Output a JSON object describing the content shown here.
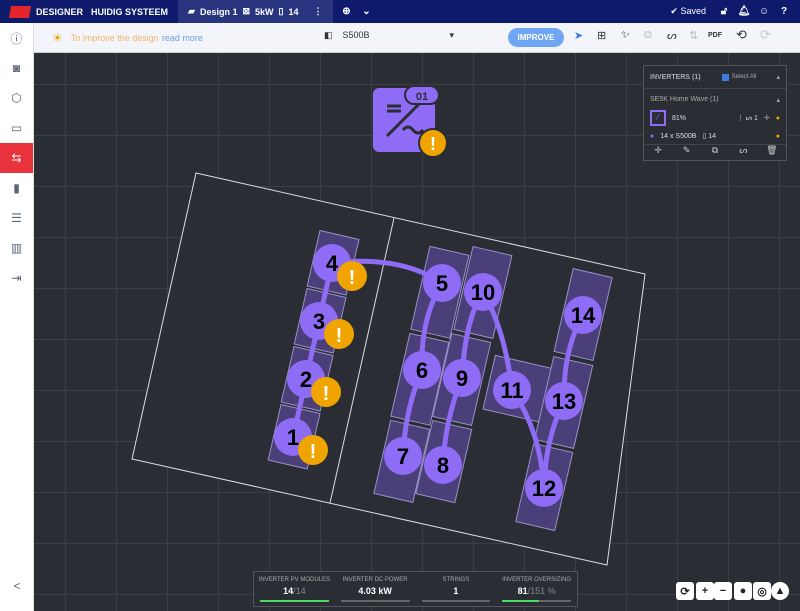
{
  "header": {
    "brand": "DESIGNER",
    "project": "HUIDIG SYSTEEM",
    "design_tab": "Design 1",
    "power": "5kW",
    "modules": "14",
    "saved": "Saved"
  },
  "sidebar": {
    "items": [
      "info",
      "camera",
      "cube",
      "panels",
      "strings",
      "inverter",
      "battery",
      "report",
      "export",
      "share"
    ],
    "active": "strings"
  },
  "toolbar": {
    "tip": "To improve the design",
    "tip_link": "read more",
    "inverter_select": "S500B",
    "improve": "IMPROVE",
    "pdf": "PDF"
  },
  "inverter_panel": {
    "title": "INVERTERS (1)",
    "select_all": "Select All",
    "group": "SE5K Home Wave (1)",
    "percent": "81%",
    "strings": "1",
    "string_info": "14 x S500B",
    "modules": "14"
  },
  "inverter_badge": "01",
  "strings": {
    "nodes": [
      "1",
      "2",
      "3",
      "4",
      "5",
      "6",
      "7",
      "8",
      "9",
      "10",
      "11",
      "12",
      "13",
      "14"
    ],
    "warnings": [
      "1",
      "2",
      "3",
      "4"
    ]
  },
  "stats": [
    {
      "label": "INVERTER PV MODULES",
      "value": "14",
      "total": "/14",
      "fill": 1.0
    },
    {
      "label": "INVERTER DC POWER",
      "value": "4.03 kW",
      "total": "",
      "fill": 0
    },
    {
      "label": "STRINGS",
      "value": "1",
      "total": "",
      "fill": 0
    },
    {
      "label": "INVERTER OVERSIZING",
      "value": "81",
      "total": "/151 %",
      "fill": 0.54
    }
  ],
  "colors": {
    "accent": "#8f6cf5",
    "warning": "#f0a400",
    "brand": "#e4262c",
    "nav": "#0e1a6b"
  }
}
